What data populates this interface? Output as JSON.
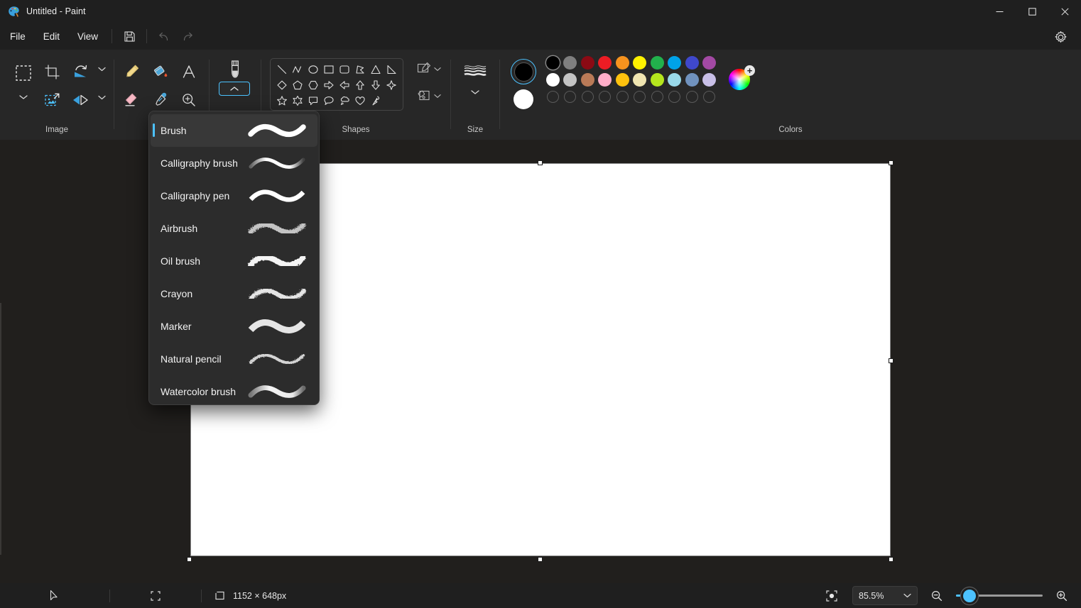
{
  "window": {
    "title": "Untitled - Paint",
    "app_icon": "paint-palette-icon",
    "minimize_label": "–",
    "maximize_label": "☐",
    "close_label": "✕"
  },
  "menubar": {
    "items": [
      {
        "label": "File",
        "name": "menu-file"
      },
      {
        "label": "Edit",
        "name": "menu-edit"
      },
      {
        "label": "View",
        "name": "menu-view"
      }
    ],
    "save_icon": "save-icon",
    "undo_icon": "undo-icon",
    "redo_icon": "redo-icon",
    "settings_icon": "gear-icon"
  },
  "ribbon": {
    "groups": [
      {
        "label": "Image",
        "name": "group-image"
      },
      {
        "label": "Shapes",
        "name": "group-shapes"
      },
      {
        "label": "Size",
        "name": "group-size"
      },
      {
        "label": "Colors",
        "name": "group-colors"
      }
    ],
    "image_tools": [
      "select-rectangle-icon",
      "crop-icon",
      "rotate-icon",
      "resize-icon",
      "flip-icon"
    ],
    "tools": [
      "pencil-icon",
      "fill-bucket-icon",
      "text-icon",
      "eraser-icon",
      "eyedropper-icon",
      "magnifier-icon"
    ],
    "brush_tool_icon": "brush-icon",
    "brush_expand_icon": "chevron-up-icon",
    "size_icon": "size-lines-icon",
    "shapes": [
      "line",
      "curve",
      "oval",
      "rectangle",
      "rounded-rectangle",
      "polygon",
      "triangle",
      "right-triangle",
      "diamond",
      "pentagon",
      "hexagon",
      "right-arrow",
      "left-arrow",
      "up-arrow",
      "down-arrow",
      "four-point-star",
      "five-point-star",
      "six-point-star",
      "rounded-rectangle-callout",
      "oval-callout",
      "cloud-callout",
      "heart",
      "lightning"
    ],
    "shape_outline_label": "outline-style-button",
    "shape_fill_label": "fill-style-button"
  },
  "colors": {
    "primary": "#000000",
    "secondary": "#ffffff",
    "row1": [
      "#000000",
      "#7f7f7f",
      "#8b0a14",
      "#ed1c24",
      "#f7931e",
      "#fff200",
      "#22b14c",
      "#00a2e8",
      "#3f48cc",
      "#a349a4"
    ],
    "row2": [
      "#ffffff",
      "#c3c3c3",
      "#b97a57",
      "#ffaec9",
      "#ffc20e",
      "#efe4b0",
      "#b5e61d",
      "#99d9ea",
      "#7092be",
      "#c8bfe7"
    ],
    "row3": [
      "",
      "",
      "",
      "",
      "",
      "",
      "",
      "",
      "",
      ""
    ],
    "wheel_icon": "color-wheel-icon",
    "wheel_plus": "+"
  },
  "brush_flyout": {
    "selected": "Brush",
    "items": [
      {
        "label": "Brush",
        "stroke": "smooth-thick"
      },
      {
        "label": "Calligraphy brush",
        "stroke": "calligraphy-tapered"
      },
      {
        "label": "Calligraphy pen",
        "stroke": "calligraphy-pen"
      },
      {
        "label": "Airbrush",
        "stroke": "airbrush-speckle"
      },
      {
        "label": "Oil brush",
        "stroke": "oil-textured"
      },
      {
        "label": "Crayon",
        "stroke": "crayon-grainy"
      },
      {
        "label": "Marker",
        "stroke": "marker-flat"
      },
      {
        "label": "Natural pencil",
        "stroke": "pencil-grainy"
      },
      {
        "label": "Watercolor brush",
        "stroke": "watercolor-soft"
      }
    ]
  },
  "statusbar": {
    "cursor_icon": "cursor-arrow-icon",
    "selection_icon": "selection-dashed-icon",
    "canvas_icon": "canvas-size-icon",
    "canvas_size": "1152 × 648px",
    "fit_icon": "fit-to-window-icon",
    "zoom_value": "85.5%",
    "zoom_chevron": "chevron-down-icon",
    "zoom_out_icon": "zoom-out-icon",
    "zoom_in_icon": "zoom-in-icon"
  },
  "theme": {
    "accent": "#4cc2ff",
    "chrome_bg": "#1f1f1f",
    "ribbon_bg": "#272727",
    "canvas_bg": "#211f1d"
  }
}
